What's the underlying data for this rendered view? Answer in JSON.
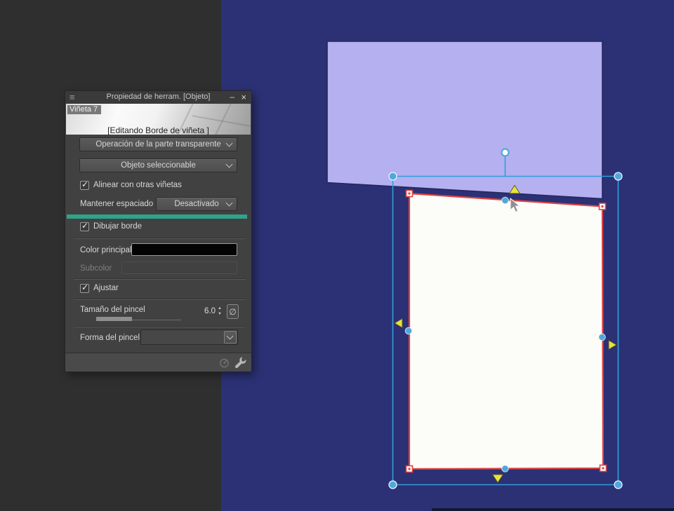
{
  "window": {
    "title": "Propiedad de herram. [Objeto]"
  },
  "icons": {
    "menu": "≡",
    "minimize": "–",
    "close": "×",
    "check": "✓",
    "no_entry": "∅",
    "spinner_up": "▲",
    "spinner_down": "▼"
  },
  "tool_panel": {
    "preview_badge": "Viñeta 7",
    "editing_status": "[Editando Borde de viñeta ]",
    "operation_dropdown": {
      "label": "Operación de la parte transparente"
    },
    "selectable_dropdown": {
      "label": "Objeto seleccionable"
    },
    "align_checkbox": {
      "label": "Alinear con otras viñetas",
      "checked": true
    },
    "keep_spacing": {
      "label": "Mantener espaciado",
      "value": "Desactivado"
    },
    "draw_border_checkbox": {
      "label": "Dibujar borde",
      "checked": true
    },
    "main_color": {
      "label": "Color principal",
      "value": "#000000"
    },
    "subcolor": {
      "label": "Subcolor",
      "disabled": true
    },
    "snap_checkbox": {
      "label": "Ajustar",
      "checked": true
    },
    "brush_size": {
      "label": "Tamaño del pincel",
      "value": "6.0"
    },
    "brush_shape": {
      "label": "Forma del pincel",
      "value": ""
    }
  },
  "colors": {
    "workspace_gray": "#2f2f2f",
    "canvas_blue": "#2b3174",
    "canvas_edge_dark": "#141830",
    "frame_lavender": "#b5b0ef",
    "frame_lavender_border": "#23285e",
    "frame_white": "#fcfcf8",
    "frame_border_red": "#dd4343",
    "selection_blue": "#2f9fdd",
    "handle_blue": "#4fa8dd",
    "handle_yellow": "#e8e23c",
    "accent_teal": "#2fa38b"
  }
}
